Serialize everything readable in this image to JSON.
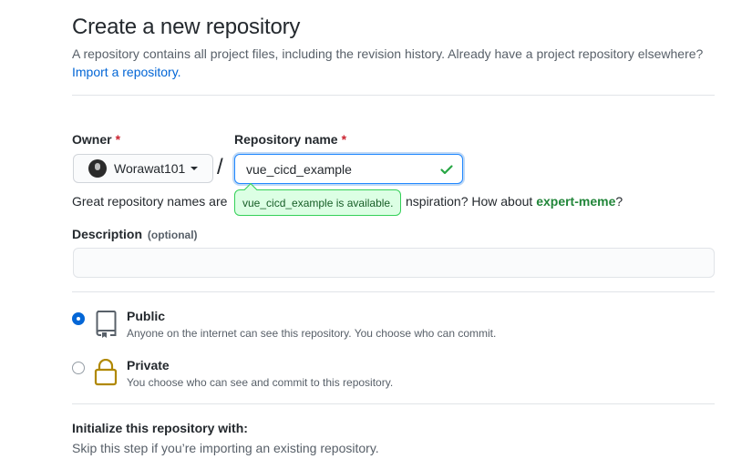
{
  "header": {
    "title": "Create a new repository",
    "subtitle_text": "A repository contains all project files, including the revision history. Already have a project repository elsewhere?",
    "import_link": "Import a repository."
  },
  "owner": {
    "label": "Owner",
    "required_mark": "*",
    "value": "Worawat101"
  },
  "separator": "/",
  "repo_name": {
    "label": "Repository name",
    "required_mark": "*",
    "value": "vue_cicd_example",
    "availability": "vue_cicd_example is available."
  },
  "hint": {
    "prefix": "Great repository names are",
    "middle": "nspiration? How about",
    "suggestion": "expert-meme",
    "suffix": "?"
  },
  "description": {
    "label": "Description",
    "optional": "(optional)",
    "value": ""
  },
  "visibility": {
    "selected": "Public",
    "public": {
      "title": "Public",
      "desc": "Anyone on the internet can see this repository. You choose who can commit.",
      "icon": "repo-icon"
    },
    "private": {
      "title": "Private",
      "desc": "You choose who can see and commit to this repository.",
      "icon": "lock-icon"
    }
  },
  "initialize": {
    "title": "Initialize this repository with:",
    "desc": "Skip this step if you’re importing an existing repository."
  },
  "colors": {
    "accent": "#0366d6",
    "success": "#28a745",
    "success_bg": "#dcffe4",
    "required": "#cb2431",
    "icon_gold": "#b08800"
  }
}
